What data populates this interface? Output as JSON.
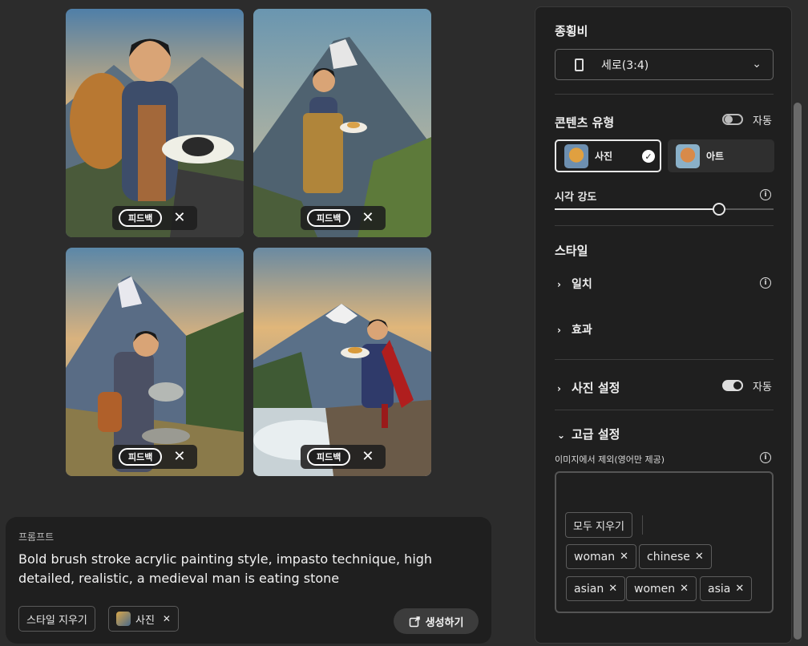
{
  "images": [
    {
      "feedback_label": "피드백"
    },
    {
      "feedback_label": "피드백"
    },
    {
      "feedback_label": "피드백"
    },
    {
      "feedback_label": "피드백"
    }
  ],
  "prompt": {
    "label": "프롬프트",
    "text": "Bold brush stroke acrylic painting style, impasto technique, high detailed, realistic, a medieval man is eating stone",
    "clear_style_label": "스타일 지우기",
    "style_chip_label": "사진",
    "generate_label": "생성하기"
  },
  "panel": {
    "aspect_title": "종횡비",
    "aspect_value": "세로(3:4)",
    "content_type_title": "콘텐츠 유형",
    "auto_label": "자동",
    "content_photo": "사진",
    "content_art": "아트",
    "visual_intensity_label": "시각 강도",
    "visual_intensity_value": 0.75,
    "style_title": "스타일",
    "match_label": "일치",
    "effects_label": "효과",
    "photo_settings_label": "사진 설정",
    "photo_auto_label": "자동",
    "advanced_label": "고급 설정",
    "exclude_label": "이미지에서 제외(영어만 제공)",
    "clear_all_label": "모두 지우기",
    "exclude_tags": [
      "woman",
      "chinese",
      "asian",
      "women",
      "asia"
    ]
  }
}
